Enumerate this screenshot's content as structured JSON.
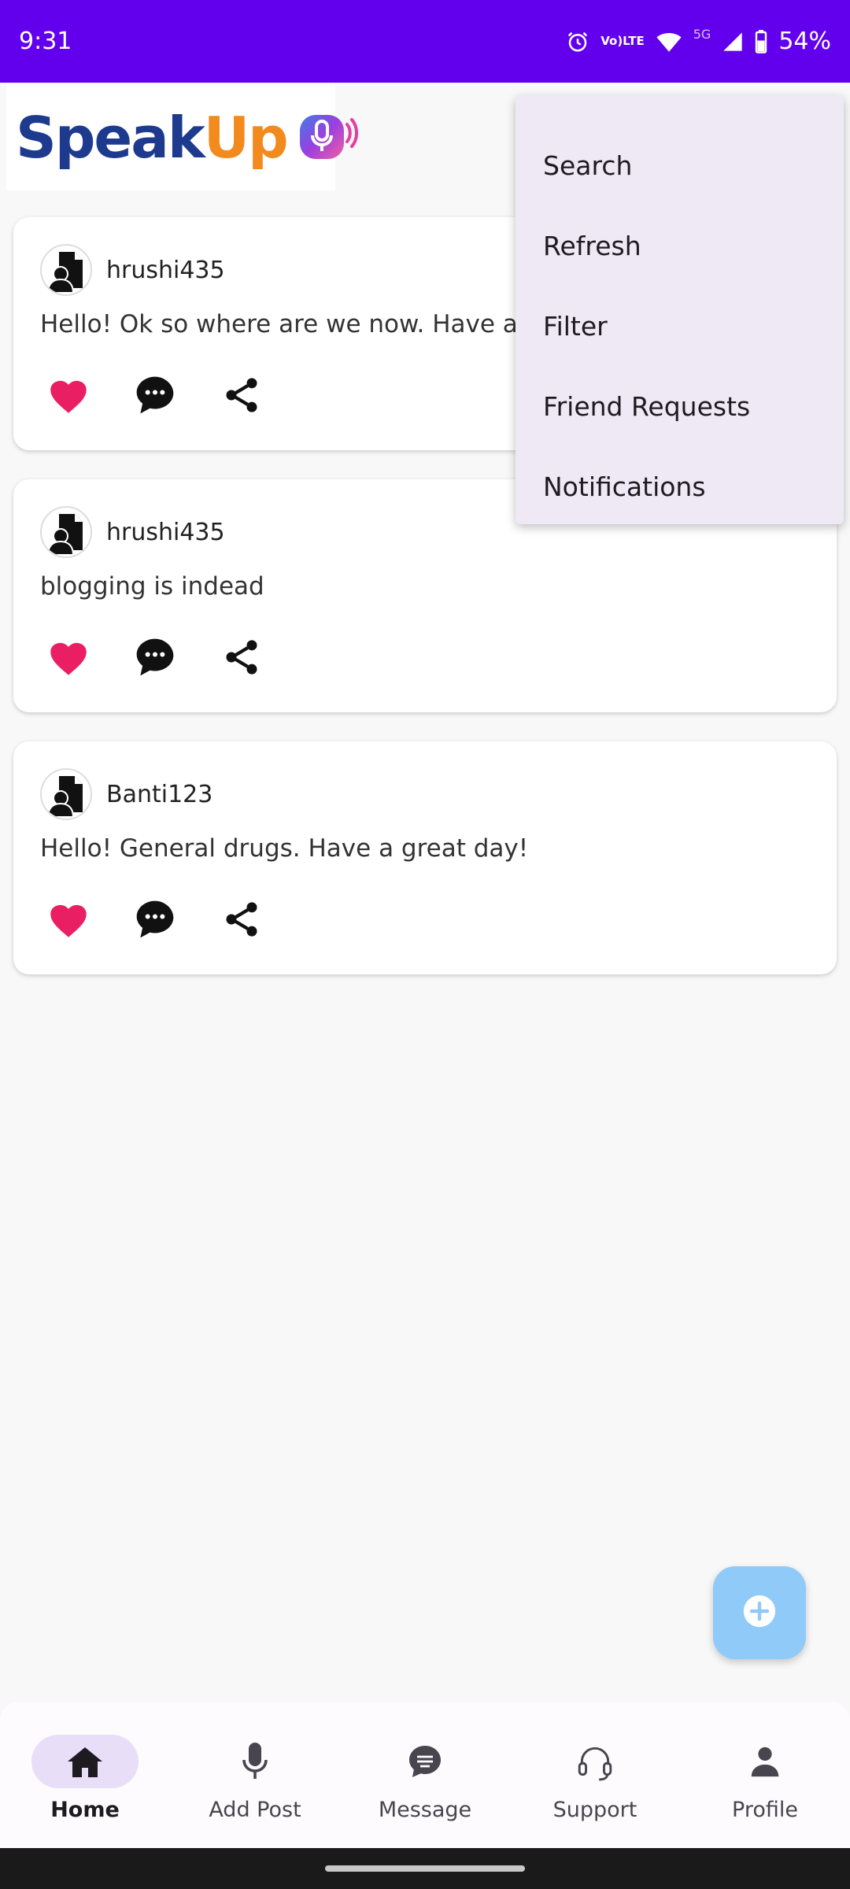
{
  "status_bar": {
    "time": "9:31",
    "lte_top": "Vo)",
    "lte_bottom": "LTE",
    "network": "5G",
    "battery": "54%"
  },
  "logo": {
    "part1": "Speak",
    "part2": "Up"
  },
  "posts": [
    {
      "username": "hrushi435",
      "text": "Hello! Ok so where are we now. Have a gr"
    },
    {
      "username": "hrushi435",
      "text": "blogging is indead"
    },
    {
      "username": "Banti123",
      "text": "Hello! General drugs. Have a great day!"
    }
  ],
  "menu": {
    "items": [
      "Search",
      "Refresh",
      "Filter",
      "Friend Requests",
      "Notifications"
    ]
  },
  "bottom_nav": {
    "items": [
      {
        "label": "Home",
        "icon": "home-icon",
        "active": true
      },
      {
        "label": "Add Post",
        "icon": "microphone-icon"
      },
      {
        "label": "Message",
        "icon": "chat-icon"
      },
      {
        "label": "Support",
        "icon": "headset-icon"
      },
      {
        "label": "Profile",
        "icon": "person-icon"
      }
    ]
  },
  "colors": {
    "status_bar": "#6200ee",
    "fab": "#90caf9",
    "heart": "#e91e63",
    "nav_active": "#e8def8"
  }
}
